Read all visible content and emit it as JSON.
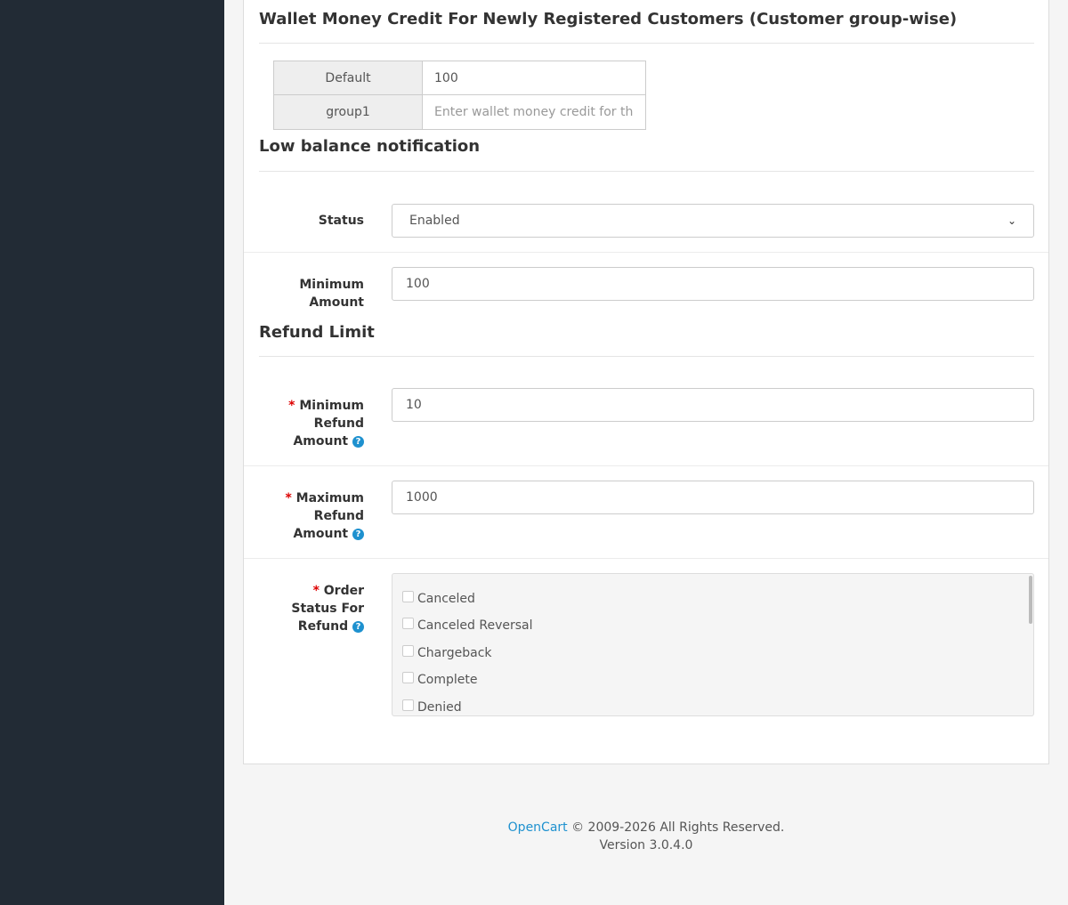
{
  "wallet_section": {
    "title": "Wallet Money Credit For Newly Registered Customers (Customer group-wise)",
    "groups": [
      {
        "label": "Default",
        "value": "100",
        "placeholder": ""
      },
      {
        "label": "group1",
        "value": "",
        "placeholder": "Enter wallet money credit for this group"
      }
    ]
  },
  "low_balance": {
    "title": "Low balance notification",
    "status_label": "Status",
    "status_value": "Enabled",
    "min_amount_label": "Minimum Amount",
    "min_amount_value": "100"
  },
  "refund_limit": {
    "title": "Refund Limit",
    "required_mark": "*",
    "min_refund_label": "Minimum Refund Amount",
    "min_refund_value": "10",
    "max_refund_label": "Maximum Refund Amount",
    "max_refund_value": "1000",
    "order_status_label": "Order Status For Refund",
    "order_statuses": [
      "Canceled",
      "Canceled Reversal",
      "Chargeback",
      "Complete",
      "Denied"
    ]
  },
  "icons": {
    "help": "question-circle-icon",
    "dropdown": "chevron-down-icon"
  },
  "colors": {
    "sidebar": "#222b35",
    "link": "#1e91cf",
    "required": "#dd0000"
  },
  "footer": {
    "brand_link": "OpenCart",
    "copyright": " © 2009-2026 All Rights Reserved.",
    "version": "Version 3.0.4.0"
  }
}
